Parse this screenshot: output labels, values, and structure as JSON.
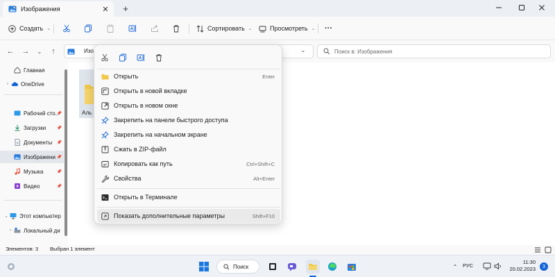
{
  "window": {
    "tab_title": "Изображения"
  },
  "commandbar": {
    "create_label": "Создать",
    "sort_label": "Сортировать",
    "view_label": "Просмотреть"
  },
  "address": {
    "crumb": "Изо",
    "search_placeholder": "Поиск в: Изображения"
  },
  "nav": {
    "home": "Главная",
    "onedrive": "OneDrive",
    "desktop": "Рабочий сто..",
    "downloads": "Загрузки",
    "documents": "Документы",
    "pictures": "Изображени",
    "music": "Музыка",
    "videos": "Видео",
    "thispc": "Этот компьютер",
    "localdisk": "Локальный ди"
  },
  "content": {
    "folder_label": "Аль"
  },
  "context_menu": {
    "items": [
      {
        "label": "Открыть",
        "shortcut": "Enter",
        "icon": "folder-icon"
      },
      {
        "label": "Открыть в новой вкладке",
        "shortcut": "",
        "icon": "new-tab-icon"
      },
      {
        "label": "Открыть в новом окне",
        "shortcut": "",
        "icon": "new-window-icon"
      },
      {
        "label": "Закрепить на панели быстрого доступа",
        "shortcut": "",
        "icon": "pin-icon"
      },
      {
        "label": "Закрепить на начальном экране",
        "shortcut": "",
        "icon": "pin-icon"
      },
      {
        "label": "Сжать в ZIP-файл",
        "shortcut": "",
        "icon": "zip-icon"
      },
      {
        "label": "Копировать как путь",
        "shortcut": "Ctrl+Shift+C",
        "icon": "copy-path-icon"
      },
      {
        "label": "Свойства",
        "shortcut": "Alt+Enter",
        "icon": "wrench-icon"
      },
      {
        "label": "Открыть в Терминале",
        "shortcut": "",
        "icon": "terminal-icon"
      },
      {
        "label": "Показать дополнительные параметры",
        "shortcut": "Shift+F10",
        "icon": "more-options-icon"
      }
    ]
  },
  "status": {
    "count": "Элементов: 3",
    "selected": "Выбран 1 элемент"
  },
  "taskbar": {
    "search_label": "Поиск",
    "lang": "РУС",
    "time": "11:30",
    "date": "20.02.2023",
    "notifications": "3"
  },
  "colors": {
    "accent": "#1464d6",
    "folder": "#f2c94c"
  }
}
